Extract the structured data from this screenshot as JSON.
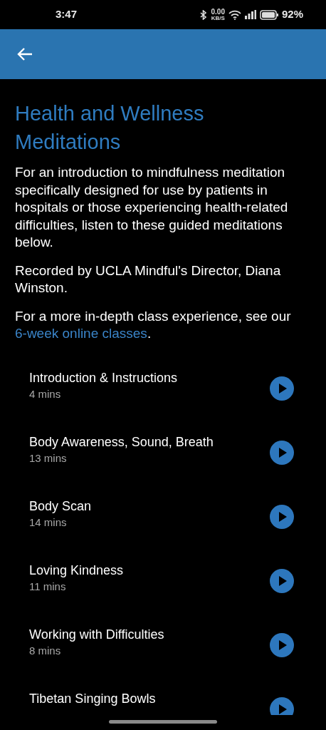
{
  "status_bar": {
    "time": "3:47",
    "speed_value": "0.00",
    "speed_unit": "KB/S",
    "battery": "92%"
  },
  "title": "Health and Wellness Meditations",
  "intro": "For an introduction to mindfulness meditation specifically designed for use by patients in hospitals or those experiencing health-related difficulties, listen to these guided meditations below.",
  "credit": "Recorded by UCLA Mindful's Director, Diana Winston.",
  "more": {
    "text": "For a more in-depth class experience, see our",
    "link": "6-week online classes",
    "after": "."
  },
  "tracks": [
    {
      "title": "Introduction & Instructions",
      "duration": "4 mins"
    },
    {
      "title": "Body Awareness, Sound, Breath",
      "duration": "13 mins"
    },
    {
      "title": "Body Scan",
      "duration": "14 mins"
    },
    {
      "title": "Loving Kindness",
      "duration": "11 mins"
    },
    {
      "title": "Working with Difficulties",
      "duration": "8 mins"
    },
    {
      "title": "Tibetan Singing Bowls"
    }
  ]
}
